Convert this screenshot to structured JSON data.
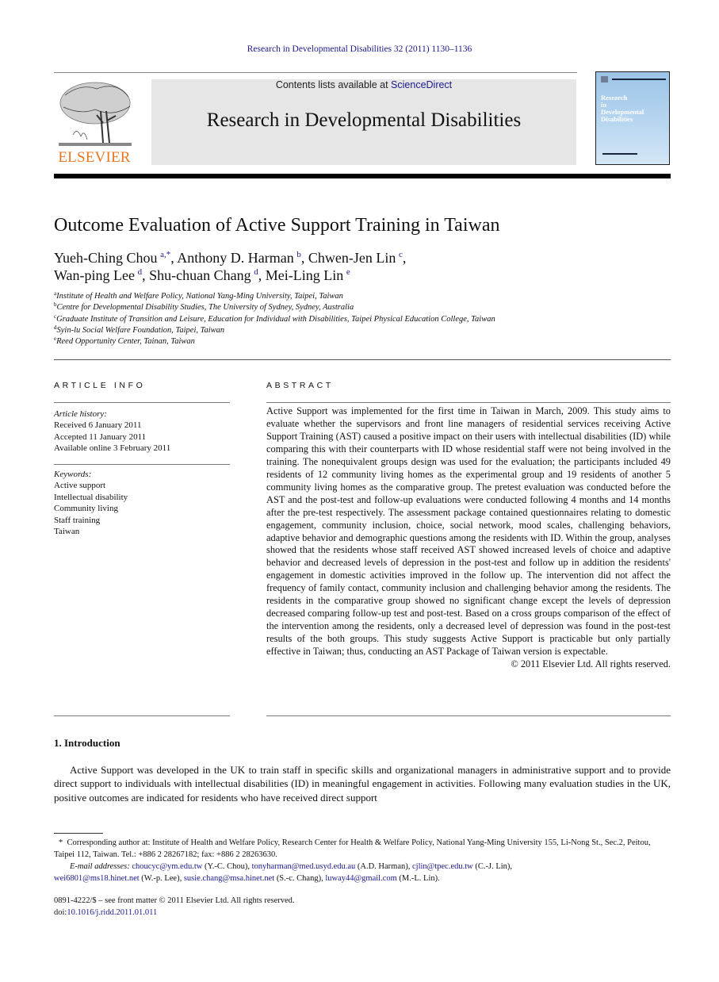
{
  "header": {
    "journal_reference": "Research in Developmental Disabilities 32 (2011) 1130–1136",
    "contents_prefix": "Contents lists available at ",
    "contents_link": "ScienceDirect",
    "journal_title": "Research in Developmental Disabilities",
    "publisher_wordmark": "ELSEVIER",
    "cover_title": [
      "Research",
      "in",
      "Developmental",
      "Disabilities"
    ],
    "colors": {
      "link": "#1a1a8c",
      "elsevier_orange": "#e87722",
      "banner_bg": "#e6e6e6",
      "cover_blue": "#9cc4e6"
    }
  },
  "article": {
    "title": "Outcome Evaluation of Active Support Training in Taiwan",
    "authors": [
      {
        "name": "Yueh-Ching Chou",
        "sup": "a,*",
        "sep": ", "
      },
      {
        "name": "Anthony D. Harman",
        "sup": "b",
        "sep": ", "
      },
      {
        "name": "Chwen-Jen Lin",
        "sup": "c",
        "sep": ","
      },
      {
        "name": "Wan-ping Lee",
        "sup": "d",
        "sep": ", "
      },
      {
        "name": "Shu-chuan Chang",
        "sup": "d",
        "sep": ", "
      },
      {
        "name": "Mei-Ling Lin",
        "sup": "e",
        "sep": ""
      }
    ],
    "affiliations": [
      {
        "key": "a",
        "text": "Institute of Health and Welfare Policy, National Yang-Ming University, Taipei, Taiwan"
      },
      {
        "key": "b",
        "text": "Centre for Developmental Disability Studies, The University of Sydney, Sydney, Australia"
      },
      {
        "key": "c",
        "text": "Graduate Institute of Transition and Leisure, Education for Individual with Disabilities, Taipei Physical Education College, Taiwan"
      },
      {
        "key": "d",
        "text": "Syin-lu Social Welfare Foundation, Taipei, Taiwan"
      },
      {
        "key": "e",
        "text": "Reed Opportunity Center, Tainan, Taiwan"
      }
    ]
  },
  "article_info": {
    "label": "ARTICLE INFO",
    "history_heading": "Article history:",
    "history": [
      "Received 6 January 2011",
      "Accepted 11 January 2011",
      "Available online 3 February 2011"
    ],
    "keywords_heading": "Keywords:",
    "keywords": [
      "Active support",
      "Intellectual disability",
      "Community living",
      "Staff training",
      "Taiwan"
    ]
  },
  "abstract": {
    "label": "ABSTRACT",
    "text": "Active Support was implemented for the first time in Taiwan in March, 2009. This study aims to evaluate whether the supervisors and front line managers of residential services receiving Active Support Training (AST) caused a positive impact on their users with intellectual disabilities (ID) while comparing this with their counterparts with ID whose residential staff were not being involved in the training. The nonequivalent groups design was used for the evaluation; the participants included 49 residents of 12 community living homes as the experimental group and 19 residents of another 5 community living homes as the comparative group. The pretest evaluation was conducted before the AST and the post-test and follow-up evaluations were conducted following 4 months and 14 months after the pre-test respectively. The assessment package contained questionnaires relating to domestic engagement, community inclusion, choice, social network, mood scales, challenging behaviors, adaptive behavior and demographic questions among the residents with ID. Within the group, analyses showed that the residents whose staff received AST showed increased levels of choice and adaptive behavior and decreased levels of depression in the post-test and follow up in addition the residents' engagement in domestic activities improved in the follow up. The intervention did not affect the frequency of family contact, community inclusion and challenging behavior among the residents. The residents in the comparative group showed no significant change except the levels of depression decreased comparing follow-up test and post-test. Based on a cross groups comparison of the effect of the intervention among the residents, only a decreased level of depression was found in the post-test results of the both groups. This study suggests Active Support is practicable but only partially effective in Taiwan; thus, conducting an AST Package of Taiwan version is expectable.",
    "copyright": "© 2011 Elsevier Ltd. All rights reserved."
  },
  "introduction": {
    "heading": "1.  Introduction",
    "text": "Active Support was developed in the UK to train staff in specific skills and organizational managers in administrative support and to provide direct support to individuals with intellectual disabilities (ID) in meaningful engagement in activities. Following many evaluation studies in the UK, positive outcomes are indicated for residents who have received direct support"
  },
  "footnote": {
    "marker": "*",
    "corresponding": "Corresponding author at: Institute of Health and Welfare Policy, Research Center for Health & Welfare Policy, National Yang-Ming University 155, Li-Nong St., Sec.2, Peitou, Taipei 112, Taiwan. Tel.: +886 2 28267182; fax: +886 2 28263630.",
    "email_label": "E-mail addresses:",
    "emails": [
      {
        "address": "choucyc@ym.edu.tw",
        "who": " (Y.-C. Chou), "
      },
      {
        "address": "tonyharman@med.usyd.edu.au",
        "who": " (A.D. Harman), "
      },
      {
        "address": "cjlin@tpec.edu.tw",
        "who": " (C.-J. Lin), "
      },
      {
        "address": "wei6801@ms18.hinet.net",
        "who": " (W.-p. Lee), "
      },
      {
        "address": "susie.chang@msa.hinet.net",
        "who": " (S.-c. Chang), "
      },
      {
        "address": "luway44@gmail.com",
        "who": " (M.-L. Lin)."
      }
    ]
  },
  "issn": {
    "line": "0891-4222/$ – see front matter © 2011 Elsevier Ltd. All rights reserved.",
    "doi_prefix": "doi:",
    "doi": "10.1016/j.ridd.2011.01.011"
  }
}
